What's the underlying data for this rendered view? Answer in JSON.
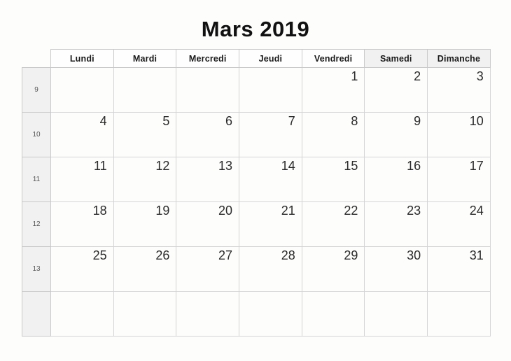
{
  "header": {
    "title": "Mars 2019"
  },
  "calendar": {
    "weekday_headers": [
      {
        "label": "Lundi",
        "weekend": false
      },
      {
        "label": "Mardi",
        "weekend": false
      },
      {
        "label": "Mercredi",
        "weekend": false
      },
      {
        "label": "Jeudi",
        "weekend": false
      },
      {
        "label": "Vendredi",
        "weekend": false
      },
      {
        "label": "Samedi",
        "weekend": true
      },
      {
        "label": "Dimanche",
        "weekend": true
      }
    ],
    "week_numbers": [
      "9",
      "10",
      "11",
      "12",
      "13",
      ""
    ],
    "weeks": [
      {
        "week": "9",
        "days": [
          "",
          "",
          "",
          "",
          "1",
          "2",
          "3"
        ]
      },
      {
        "week": "10",
        "days": [
          "4",
          "5",
          "6",
          "7",
          "8",
          "9",
          "10"
        ]
      },
      {
        "week": "11",
        "days": [
          "11",
          "12",
          "13",
          "14",
          "15",
          "16",
          "17"
        ]
      },
      {
        "week": "12",
        "days": [
          "18",
          "19",
          "20",
          "21",
          "22",
          "23",
          "24"
        ]
      },
      {
        "week": "13",
        "days": [
          "25",
          "26",
          "27",
          "28",
          "29",
          "30",
          "31"
        ]
      },
      {
        "week": "",
        "days": [
          "",
          "",
          "",
          "",
          "",
          "",
          ""
        ]
      }
    ]
  },
  "colors": {
    "page_background": "#fdfdfc",
    "title_text": "#111111",
    "grid_border": "#c9c9c9",
    "cell_border": "#d4d4d4",
    "shaded_cell": "#f1f1f1",
    "day_number_text": "#2b2b2b",
    "week_number_text": "#555555"
  }
}
